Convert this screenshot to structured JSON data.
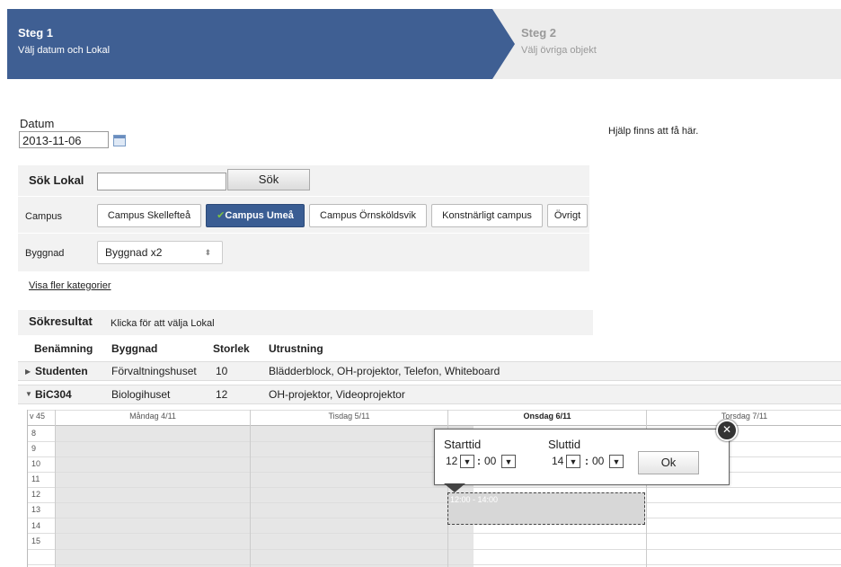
{
  "steps": [
    {
      "title": "Steg 1",
      "subtitle": "Välj datum och Lokal"
    },
    {
      "title": "Steg 2",
      "subtitle": "Välj övriga objekt"
    }
  ],
  "help": "Hjälp finns att få här.",
  "date": {
    "label": "Datum",
    "value": "2013-11-06"
  },
  "search": {
    "label": "Sök Lokal",
    "button": "Sök",
    "value": ""
  },
  "campus": {
    "label": "Campus",
    "options": [
      "Campus Skellefteå",
      "Campus Umeå",
      "Campus Örnsköldsvik",
      "Konstnärligt campus",
      "Övrigt"
    ],
    "selected_check": "✔"
  },
  "building": {
    "label": "Byggnad",
    "selected": "Byggnad x2"
  },
  "more_link": "Visa fler kategorier",
  "results": {
    "title": "Sökresultat",
    "hint": "Klicka för att välja Lokal",
    "columns": [
      "Benämning",
      "Byggnad",
      "Storlek",
      "Utrustning"
    ],
    "rows": [
      {
        "name": "Studenten",
        "building": "Förvaltningshuset",
        "size": "10",
        "equipment": "Blädderblock, OH-projektor, Telefon, Whiteboard"
      },
      {
        "name": "BiC304",
        "building": "Biologihuset",
        "size": "12",
        "equipment": "OH-projektor, Videoprojektor"
      }
    ]
  },
  "schedule": {
    "week": "v 45",
    "days": [
      "Måndag 4/11",
      "Tisdag 5/11",
      "Onsdag 6/11",
      "Torsdag 7/11"
    ],
    "hours": [
      "8",
      "9",
      "10",
      "11",
      "12",
      "13",
      "14",
      "15"
    ],
    "booking": "12:00 - 14:00"
  },
  "popup": {
    "start_label": "Starttid",
    "end_label": "Sluttid",
    "start_hour": "12",
    "start_min": "00",
    "end_hour": "14",
    "end_min": "00",
    "colon": ":",
    "ok": "Ok",
    "close": "✕"
  },
  "colors": {
    "accent": "#3f5f93",
    "selected": "#3a5d93",
    "check": "#7cc243"
  }
}
